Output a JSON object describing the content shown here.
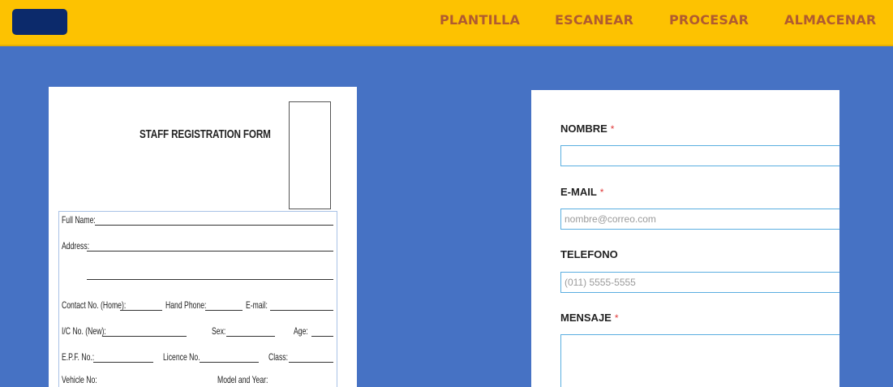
{
  "nav": {
    "items": [
      {
        "label": "PLANTILLA"
      },
      {
        "label": "ESCANEAR"
      },
      {
        "label": "PROCESAR"
      },
      {
        "label": "ALMACENAR"
      }
    ]
  },
  "colors": {
    "header_bg": "#fdc201",
    "logo_bg": "#0c2a6b",
    "nav_text": "#b05b30",
    "page_bg": "#4672c4",
    "input_border": "#5aaee0",
    "required_mark": "#e03a3a"
  },
  "paper_form": {
    "title": "STAFF REGISTRATION FORM",
    "fields": {
      "full_name": "Full Name:",
      "address": "Address:",
      "contact_home": "Contact No. (Home):",
      "hand_phone": "Hand Phone:",
      "email": "E-mail:",
      "ic_no": "I/C No. (New):",
      "sex": "Sex:",
      "age": "Age:",
      "epf_no": "E.P.F. No.:",
      "licence_no": "Licence No.",
      "class": "Class:",
      "vehicle_no": "Vehicle No:",
      "model_year": "Model and Year:"
    }
  },
  "web_form": {
    "nombre": {
      "label": "NOMBRE",
      "required": "*",
      "value": "",
      "placeholder": ""
    },
    "email": {
      "label": "E-MAIL",
      "required": "*",
      "value": "",
      "placeholder": "nombre@correo.com"
    },
    "telefono": {
      "label": "TELEFONO",
      "value": "",
      "placeholder": "(011) 5555-5555"
    },
    "mensaje": {
      "label": "MENSAJE",
      "required": "*",
      "value": ""
    }
  }
}
